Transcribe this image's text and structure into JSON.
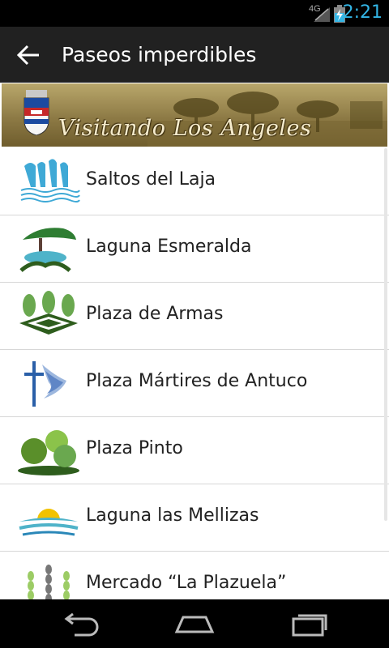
{
  "status_bar": {
    "network": "4G",
    "time": "2:21"
  },
  "action_bar": {
    "title": "Paseos imperdibles",
    "back_icon": "arrow-back-icon"
  },
  "banner": {
    "text": "Visitando Los Angeles"
  },
  "list": {
    "items": [
      {
        "label": "Saltos del Laja",
        "icon": "waterfall-icon"
      },
      {
        "label": "Laguna Esmeralda",
        "icon": "tree-lagoon-icon"
      },
      {
        "label": "Plaza de Armas",
        "icon": "plaza-trees-icon"
      },
      {
        "label": "Plaza Mártires de Antuco",
        "icon": "cross-flame-icon"
      },
      {
        "label": "Plaza Pinto",
        "icon": "bushes-icon"
      },
      {
        "label": "Laguna las Mellizas",
        "icon": "sunrise-lagoon-icon"
      },
      {
        "label": "Mercado “La Plazuela”",
        "icon": "wheat-icon"
      }
    ]
  },
  "nav_bar": {
    "back": "back-icon",
    "home": "home-icon",
    "recents": "recents-icon"
  },
  "colors": {
    "accent": "#33b5e5",
    "action_bar": "#212121",
    "text": "#222222"
  }
}
